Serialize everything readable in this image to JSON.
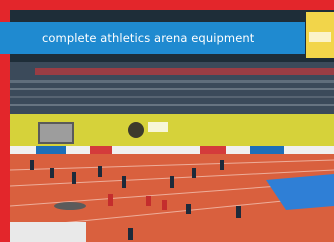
{
  "caption": "complete athletics arena equipment",
  "colors": {
    "frame_red": "#e3262b",
    "banner_blue": "#1f8ad0",
    "track_orange": "#d9603e",
    "wall_yellow": "#d6d23a",
    "jump_mat_blue": "#2f7fd6"
  }
}
